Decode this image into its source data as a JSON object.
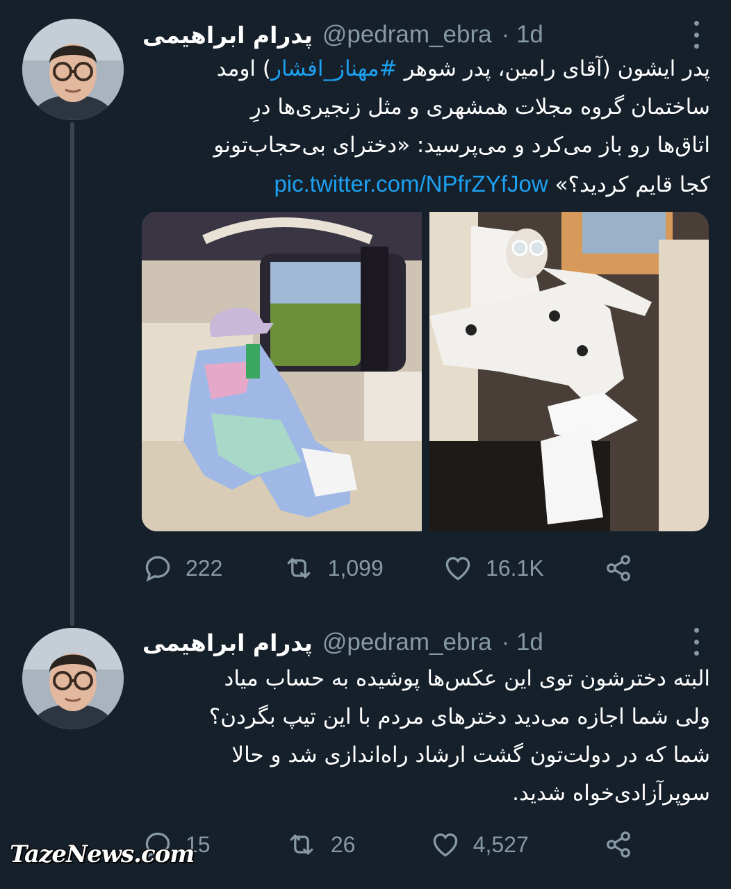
{
  "tweets": [
    {
      "display_name": "پدرام ابراهیمی",
      "handle": "@pedram_ebra",
      "time": "· 1d",
      "text_lines": {
        "l1_pre": "پدر ایشون (آقای رامین، پدر شوهر ",
        "l1_hashtag": "#مهناز_افشار",
        "l1_post": ") اومد",
        "l2": "ساختمان گروه مجلات همشهری و مثل زنجیری‌ها درِ",
        "l3": "اتاق‌ها رو باز می‌کرد و می‌پرسید: «دخترای بی‌حجاب‌تونو",
        "l4_pre": "کجا قایم کردید؟» ",
        "l4_link": "pic.twitter.com/NPfrZYfJow"
      },
      "actions": {
        "replies": "222",
        "retweets": "1,099",
        "likes": "16.1K"
      }
    },
    {
      "display_name": "پدرام ابراهیمی",
      "handle": "@pedram_ebra",
      "time": "· 1d",
      "text_lines": {
        "l1": "البته دخترشون توی این عکس‌ها پوشیده به حساب میاد",
        "l2": "ولی شما اجازه می‌دید دخترهای مردم با این تیپ بگردن؟",
        "l3": "شما که در دولت‌تون گشت ارشاد راه‌اندازی شد و حالا",
        "l4": "سوپرآزادی‌خواه شدید."
      },
      "actions": {
        "replies": "15",
        "retweets": "26",
        "likes": "4,527"
      }
    }
  ],
  "watermark": "TazeNews.com",
  "colors": {
    "background": "#15202b",
    "accent": "#1da1f2",
    "muted": "#8899a6",
    "thread_line": "#38444d"
  },
  "icons": [
    "reply-icon",
    "retweet-icon",
    "like-icon",
    "share-icon",
    "more-options-icon"
  ]
}
